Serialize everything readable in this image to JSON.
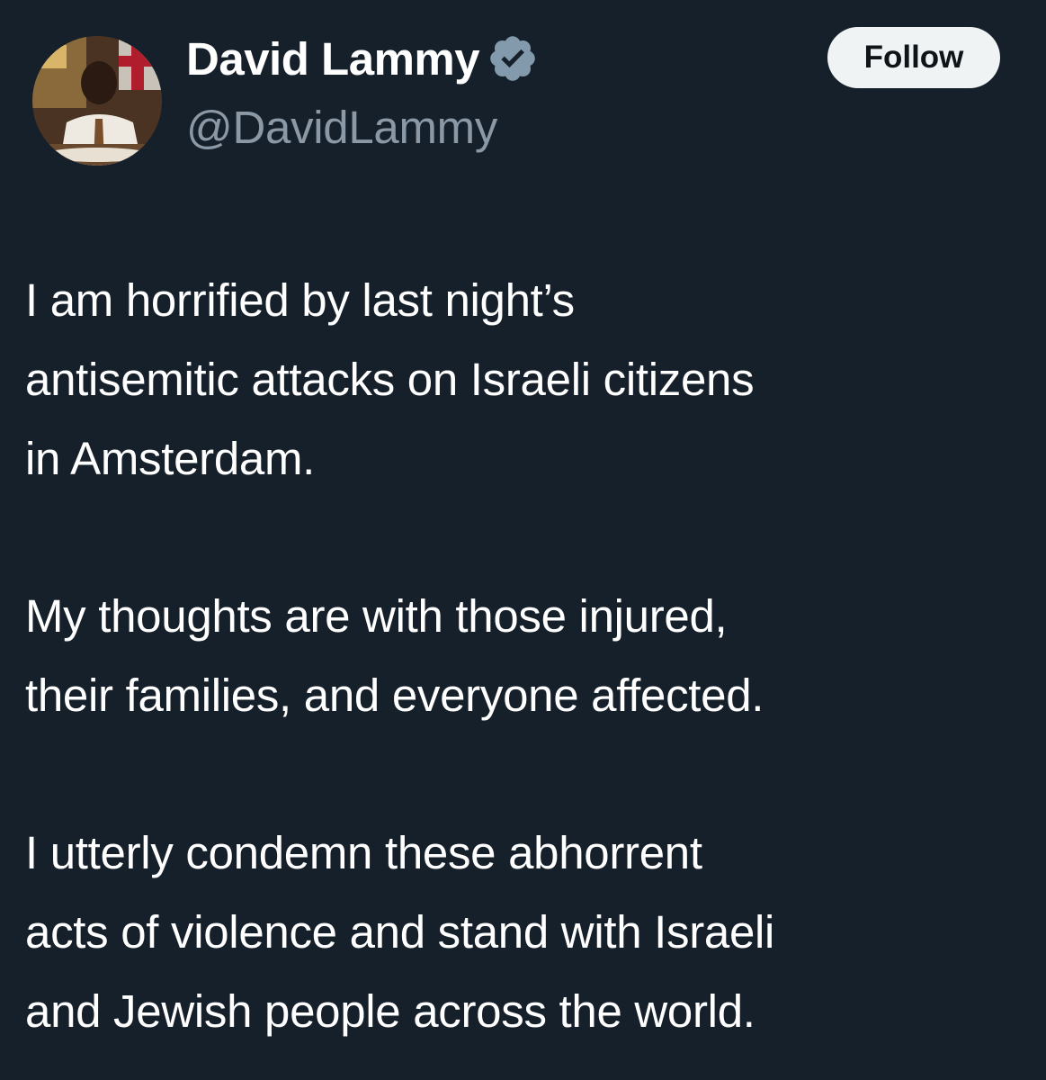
{
  "tweet": {
    "author": {
      "display_name": "David Lammy",
      "handle": "@DavidLammy",
      "verified": true
    },
    "follow_label": "Follow",
    "paragraphs": [
      [
        "I am horrified by last night’s",
        "antisemitic attacks on Israeli citizens",
        "in Amsterdam."
      ],
      [
        "My thoughts are with those injured,",
        "their families, and everyone affected."
      ],
      [
        "I utterly condemn these abhorrent",
        "acts of violence and stand with Israeli",
        "and Jewish people across the world."
      ]
    ]
  },
  "colors": {
    "background": "#16202a",
    "text": "#ffffff",
    "secondary_text": "#8b98a5",
    "follow_button_bg": "#eff3f4",
    "verified_badge": "#829aab"
  },
  "icons": {
    "verified": "verified-badge-icon",
    "avatar": "profile-photo"
  }
}
